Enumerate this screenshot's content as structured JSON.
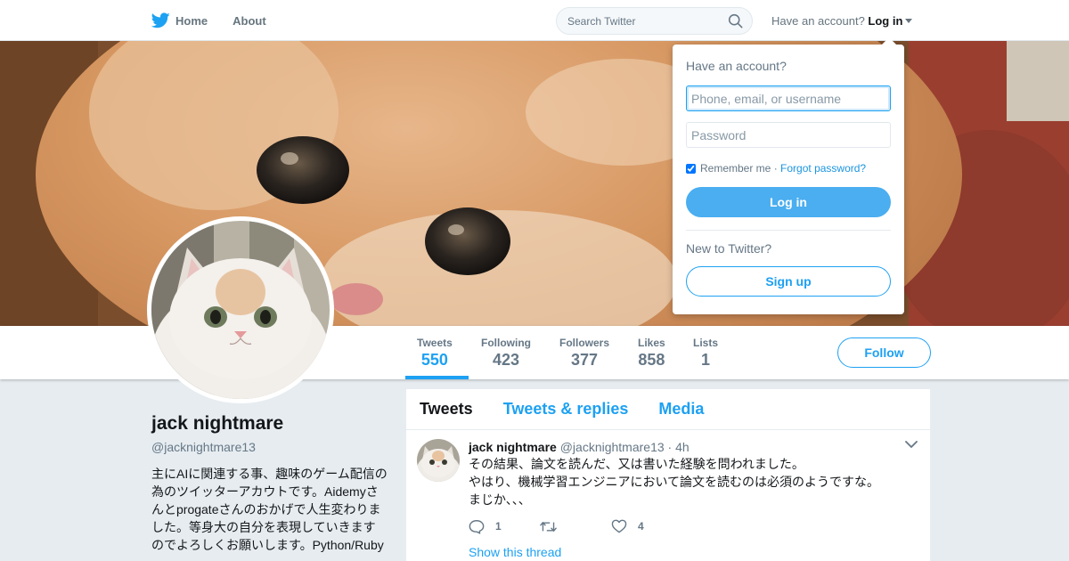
{
  "nav": {
    "home_label": "Home",
    "about_label": "About",
    "search_placeholder": "Search Twitter",
    "have_account_text": "Have an account?",
    "login_label": "Log in"
  },
  "profile": {
    "name": "jack nightmare",
    "handle": "@jacknightmare13",
    "bio": "主にAIに関連する事、趣味のゲーム配信の為のツイッターアカウトです。Aidemyさんとprogateさんのおかげで人生変わりました。等身大の自分を表現していきますのでよろしくお願いします。Python/Ruby"
  },
  "stats": [
    {
      "label": "Tweets",
      "value": "550"
    },
    {
      "label": "Following",
      "value": "423"
    },
    {
      "label": "Followers",
      "value": "377"
    },
    {
      "label": "Likes",
      "value": "858"
    },
    {
      "label": "Lists",
      "value": "1"
    }
  ],
  "follow_label": "Follow",
  "timeline_tabs": [
    "Tweets",
    "Tweets & replies",
    "Media"
  ],
  "tweet": {
    "name": "jack nightmare",
    "handle": "@jacknightmare13",
    "dot": "·",
    "time": "4h",
    "lines": [
      "その結果、論文を読んだ、又は書いた経験を問われました。",
      "やはり、機械学習エンジニアにおいて論文を読むのは必須のようですな。",
      "まじか、、、"
    ],
    "reply_count": "1",
    "retweet_count": "",
    "like_count": "4",
    "show_thread": "Show this thread"
  },
  "login_dropdown": {
    "title": "Have an account?",
    "username_placeholder": "Phone, email, or username",
    "password_placeholder": "Password",
    "remember_label": "Remember me",
    "separator": "·",
    "forgot_label": "Forgot password?",
    "login_button": "Log in",
    "new_text": "New to Twitter?",
    "signup_button": "Sign up"
  },
  "colors": {
    "accent": "#1da1f2",
    "background": "#e6ecf0",
    "muted_text": "#657786"
  }
}
